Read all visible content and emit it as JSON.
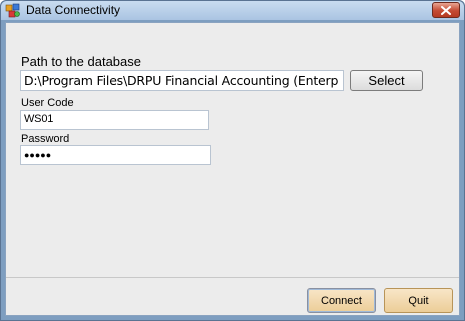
{
  "window": {
    "title": "Data Connectivity",
    "close_icon": "close-icon",
    "app_icon": "app-icon"
  },
  "form": {
    "path_label": "Path to the database",
    "path_value": "D:\\Program Files\\DRPU Financial Accounting (Enterp",
    "select_label": "Select",
    "user_code_label": "User Code",
    "user_code_value": "WS01",
    "password_label": "Password",
    "password_value": "●●●●●"
  },
  "actions": {
    "connect_label": "Connect",
    "quit_label": "Quit"
  },
  "colors": {
    "title_gradient_top": "#c9dcf0",
    "close_button": "#c44a33",
    "action_button": "#eccd98"
  }
}
